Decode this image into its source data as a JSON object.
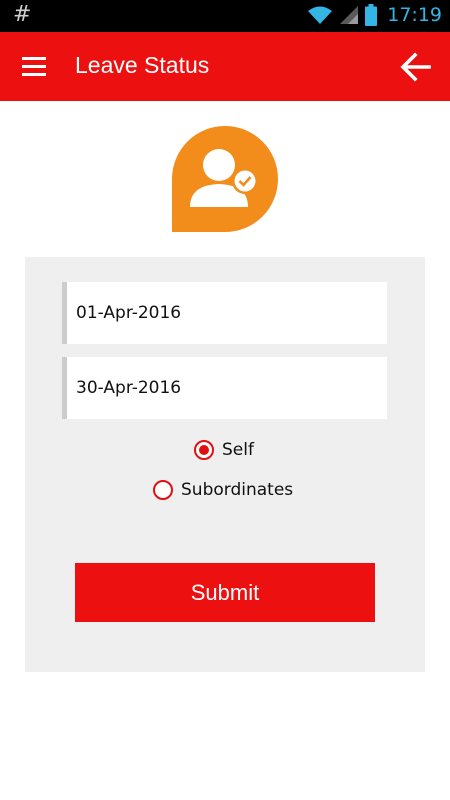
{
  "status_bar": {
    "left_glyph": "#",
    "time": "17:19",
    "icons": [
      "wifi-icon",
      "signal-icon",
      "battery-icon"
    ]
  },
  "app_bar": {
    "title": "Leave Status",
    "menu_icon": "hamburger-menu-icon",
    "back_icon": "back-arrow-icon",
    "color": "#ec1010"
  },
  "logo": {
    "icon": "user-check-icon",
    "color": "#f28c1a"
  },
  "form": {
    "from_date": "01-Apr-2016",
    "to_date": "30-Apr-2016",
    "options": [
      {
        "label": "Self",
        "selected": true
      },
      {
        "label": "Subordinates",
        "selected": false
      }
    ],
    "submit_label": "Submit",
    "accent_color": "#ec1010"
  }
}
